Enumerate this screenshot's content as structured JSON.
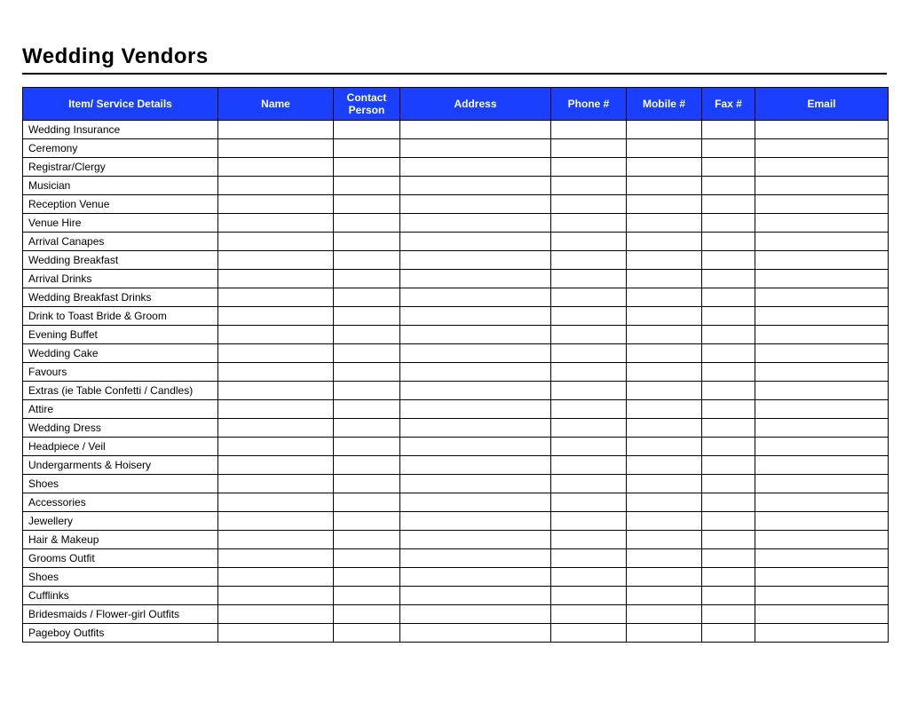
{
  "title": "Wedding Vendors",
  "columns": [
    "Item/ Service Details",
    "Name",
    "Contact Person",
    "Address",
    "Phone #",
    "Mobile #",
    "Fax #",
    "Email"
  ],
  "rows": [
    {
      "item": "Wedding Insurance",
      "name": "",
      "contact": "",
      "address": "",
      "phone": "",
      "mobile": "",
      "fax": "",
      "email": ""
    },
    {
      "item": "Ceremony",
      "name": "",
      "contact": "",
      "address": "",
      "phone": "",
      "mobile": "",
      "fax": "",
      "email": ""
    },
    {
      "item": "Registrar/Clergy",
      "name": "",
      "contact": "",
      "address": "",
      "phone": "",
      "mobile": "",
      "fax": "",
      "email": ""
    },
    {
      "item": "Musician",
      "name": "",
      "contact": "",
      "address": "",
      "phone": "",
      "mobile": "",
      "fax": "",
      "email": ""
    },
    {
      "item": "Reception Venue",
      "name": "",
      "contact": "",
      "address": "",
      "phone": "",
      "mobile": "",
      "fax": "",
      "email": ""
    },
    {
      "item": "Venue Hire",
      "name": "",
      "contact": "",
      "address": "",
      "phone": "",
      "mobile": "",
      "fax": "",
      "email": ""
    },
    {
      "item": "Arrival Canapes",
      "name": "",
      "contact": "",
      "address": "",
      "phone": "",
      "mobile": "",
      "fax": "",
      "email": ""
    },
    {
      "item": "Wedding Breakfast",
      "name": "",
      "contact": "",
      "address": "",
      "phone": "",
      "mobile": "",
      "fax": "",
      "email": ""
    },
    {
      "item": "Arrival Drinks",
      "name": "",
      "contact": "",
      "address": "",
      "phone": "",
      "mobile": "",
      "fax": "",
      "email": ""
    },
    {
      "item": "Wedding Breakfast Drinks",
      "name": "",
      "contact": "",
      "address": "",
      "phone": "",
      "mobile": "",
      "fax": "",
      "email": ""
    },
    {
      "item": "Drink to Toast Bride & Groom",
      "name": "",
      "contact": "",
      "address": "",
      "phone": "",
      "mobile": "",
      "fax": "",
      "email": ""
    },
    {
      "item": "Evening Buffet",
      "name": "",
      "contact": "",
      "address": "",
      "phone": "",
      "mobile": "",
      "fax": "",
      "email": ""
    },
    {
      "item": "Wedding Cake",
      "name": "",
      "contact": "",
      "address": "",
      "phone": "",
      "mobile": "",
      "fax": "",
      "email": ""
    },
    {
      "item": "Favours",
      "name": "",
      "contact": "",
      "address": "",
      "phone": "",
      "mobile": "",
      "fax": "",
      "email": ""
    },
    {
      "item": "Extras (ie Table Confetti / Candles)",
      "name": "",
      "contact": "",
      "address": "",
      "phone": "",
      "mobile": "",
      "fax": "",
      "email": ""
    },
    {
      "item": "Attire",
      "name": "",
      "contact": "",
      "address": "",
      "phone": "",
      "mobile": "",
      "fax": "",
      "email": ""
    },
    {
      "item": "Wedding Dress",
      "name": "",
      "contact": "",
      "address": "",
      "phone": "",
      "mobile": "",
      "fax": "",
      "email": ""
    },
    {
      "item": "Headpiece / Veil",
      "name": "",
      "contact": "",
      "address": "",
      "phone": "",
      "mobile": "",
      "fax": "",
      "email": ""
    },
    {
      "item": "Undergarments & Hoisery",
      "name": "",
      "contact": "",
      "address": "",
      "phone": "",
      "mobile": "",
      "fax": "",
      "email": ""
    },
    {
      "item": "Shoes",
      "name": "",
      "contact": "",
      "address": "",
      "phone": "",
      "mobile": "",
      "fax": "",
      "email": ""
    },
    {
      "item": "Accessories",
      "name": "",
      "contact": "",
      "address": "",
      "phone": "",
      "mobile": "",
      "fax": "",
      "email": ""
    },
    {
      "item": "Jewellery",
      "name": "",
      "contact": "",
      "address": "",
      "phone": "",
      "mobile": "",
      "fax": "",
      "email": ""
    },
    {
      "item": "Hair & Makeup",
      "name": "",
      "contact": "",
      "address": "",
      "phone": "",
      "mobile": "",
      "fax": "",
      "email": ""
    },
    {
      "item": "Grooms Outfit",
      "name": "",
      "contact": "",
      "address": "",
      "phone": "",
      "mobile": "",
      "fax": "",
      "email": ""
    },
    {
      "item": "Shoes",
      "name": "",
      "contact": "",
      "address": "",
      "phone": "",
      "mobile": "",
      "fax": "",
      "email": ""
    },
    {
      "item": "Cufflinks",
      "name": "",
      "contact": "",
      "address": "",
      "phone": "",
      "mobile": "",
      "fax": "",
      "email": ""
    },
    {
      "item": "Bridesmaids / Flower-girl Outfits",
      "name": "",
      "contact": "",
      "address": "",
      "phone": "",
      "mobile": "",
      "fax": "",
      "email": ""
    },
    {
      "item": "Pageboy Outfits",
      "name": "",
      "contact": "",
      "address": "",
      "phone": "",
      "mobile": "",
      "fax": "",
      "email": ""
    }
  ]
}
